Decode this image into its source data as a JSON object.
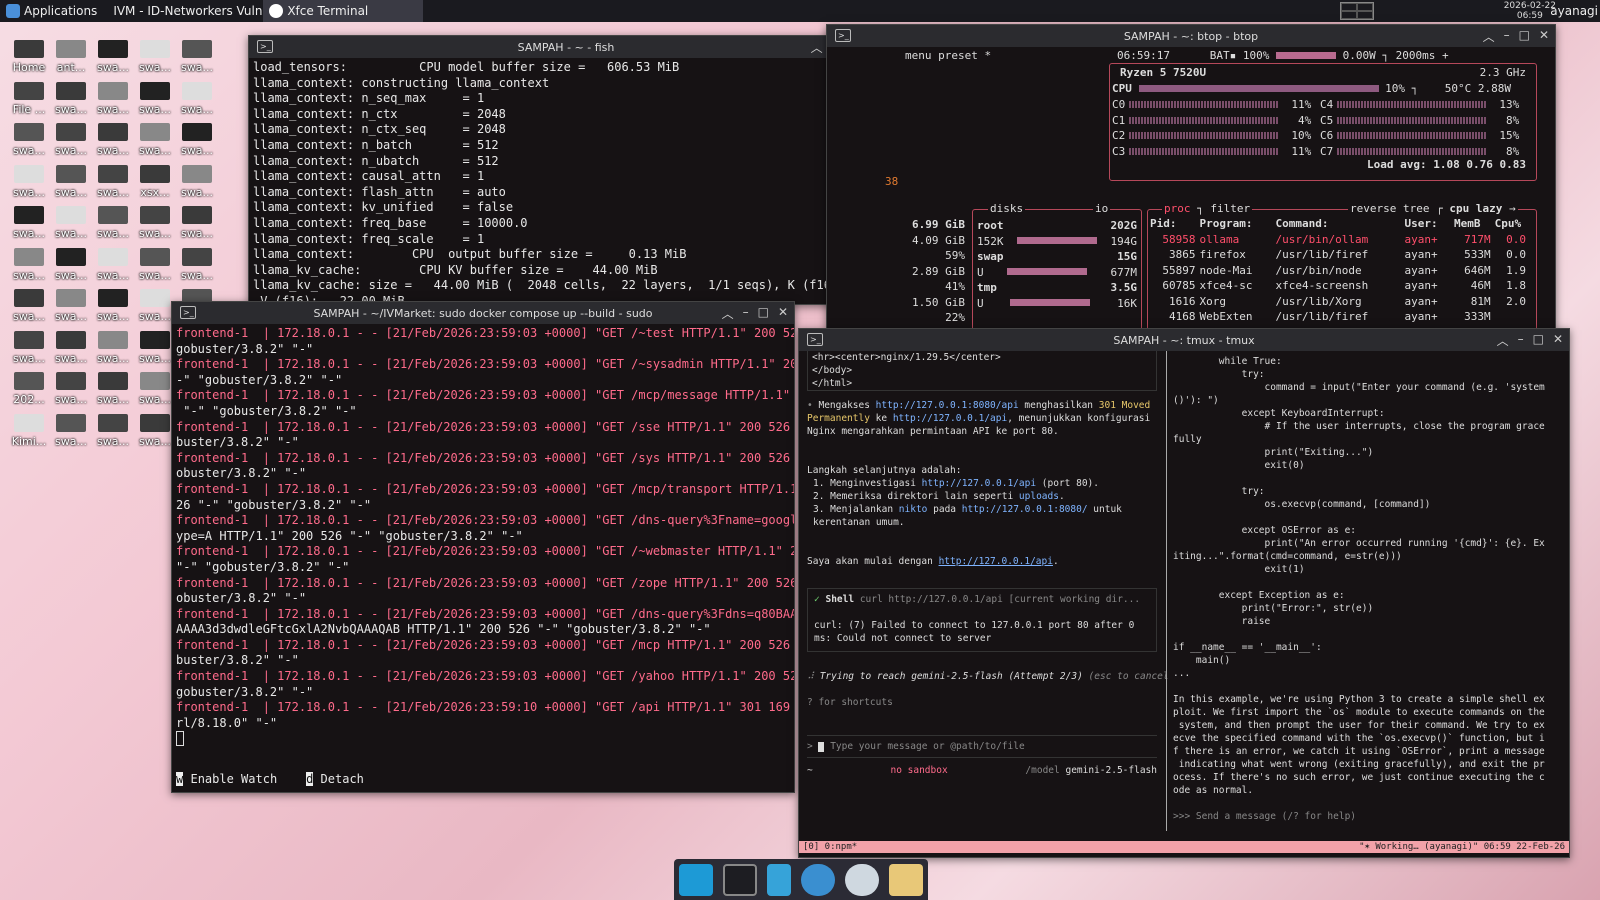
{
  "panel": {
    "applications": "Applications",
    "task1": "IVM - ID-Networkers Vuln...",
    "task2": "Xfce Terminal",
    "date": "2026-02-22",
    "time": "06:59",
    "user": "ayanagi"
  },
  "desktop": {
    "icons": [
      "Home",
      "ant...",
      "swa...",
      "swa...",
      "swa...",
      "File ...",
      "swa...",
      "swa...",
      "swa...",
      "swa...",
      "swa...",
      "swa...",
      "swa...",
      "swa...",
      "swa...",
      "swa...",
      "swa...",
      "swa...",
      "xsx...",
      "swa...",
      "swa...",
      "swa...",
      "swa...",
      "swa...",
      "swa...",
      "swa...",
      "swa...",
      "swa...",
      "swa...",
      "swa...",
      "swa...",
      "swa...",
      "swa...",
      "swa...",
      "swa...",
      "swa...",
      "swa...",
      "swa...",
      "swa...",
      "swa...",
      "202...",
      "swa...",
      "swa...",
      "swa...",
      "swa...",
      "Kimi...",
      "swa...",
      "swa...",
      "swa...",
      "swa..."
    ]
  },
  "fish": {
    "title": "SAMPAH - ~ - fish",
    "lines": [
      "load_tensors:          CPU model buffer size =   606.53 MiB",
      "llama_context: constructing llama_context",
      "llama_context: n_seq_max     = 1",
      "llama_context: n_ctx         = 2048",
      "llama_context: n_ctx_seq     = 2048",
      "llama_context: n_batch       = 512",
      "llama_context: n_ubatch      = 512",
      "llama_context: causal_attn   = 1",
      "llama_context: flash_attn    = auto",
      "llama_context: kv_unified    = false",
      "llama_context: freq_base     = 10000.0",
      "llama_context: freq_scale    = 1",
      "llama_context:        CPU  output buffer size =     0.13 MiB",
      "llama_kv_cache:        CPU KV buffer size =    44.00 MiB",
      "llama_kv_cache: size =   44.00 MiB (  2048 cells,  22 layers,  1/1 seqs), K (f16):   22.00 MiB,",
      " V (f16):   22.00 MiB"
    ]
  },
  "docker": {
    "title": "SAMPAH - ~/IVMarket: sudo docker compose up --build - sudo",
    "lines": [
      "frontend-1  | 172.18.0.1 - - [21/Feb/2026:23:59:03 +0000] \"GET /~test HTTP/1.1\" 200 526 \"-\" \"",
      "gobuster/3.8.2\" \"-\"",
      "frontend-1  | 172.18.0.1 - - [21/Feb/2026:23:59:03 +0000] \"GET /~sysadmin HTTP/1.1\" 200 526",
      "-\" \"gobuster/3.8.2\" \"-\"",
      "frontend-1  | 172.18.0.1 - - [21/Feb/2026:23:59:03 +0000] \"GET /mcp/message HTTP/1.1\" 200 526",
      " \"-\" \"gobuster/3.8.2\" \"-\"",
      "frontend-1  | 172.18.0.1 - - [21/Feb/2026:23:59:03 +0000] \"GET /sse HTTP/1.1\" 200 526 \"-\" \"go",
      "buster/3.8.2\" \"-\"",
      "frontend-1  | 172.18.0.1 - - [21/Feb/2026:23:59:03 +0000] \"GET /sys HTTP/1.1\" 200 526 \"-\" \"g",
      "obuster/3.8.2\" \"-\"",
      "frontend-1  | 172.18.0.1 - - [21/Feb/2026:23:59:03 +0000] \"GET /mcp/transport HTTP/1.1\" 200 5",
      "26 \"-\" \"gobuster/3.8.2\" \"-\"",
      "frontend-1  | 172.18.0.1 - - [21/Feb/2026:23:59:03 +0000] \"GET /dns-query%3Fname=google.com&t",
      "ype=A HTTP/1.1\" 200 526 \"-\" \"gobuster/3.8.2\" \"-\"",
      "frontend-1  | 172.18.0.1 - - [21/Feb/2026:23:59:03 +0000] \"GET /~webmaster HTTP/1.1\" 200 526",
      "\"-\" \"gobuster/3.8.2\" \"-\"",
      "frontend-1  | 172.18.0.1 - - [21/Feb/2026:23:59:03 +0000] \"GET /zope HTTP/1.1\" 200 526 \"-\" \"g",
      "obuster/3.8.2\" \"-\"",
      "frontend-1  | 172.18.0.1 - - [21/Feb/2026:23:59:03 +0000] \"GET /dns-query%3Fdns=q80BAAABAAAAA",
      "AAAA3d3dwdleGFtcGxlA2NvbQAAAQAB HTTP/1.1\" 200 526 \"-\" \"gobuster/3.8.2\" \"-\"",
      "frontend-1  | 172.18.0.1 - - [21/Feb/2026:23:59:03 +0000] \"GET /mcp HTTP/1.1\" 200 526 \"-\" \"go",
      "buster/3.8.2\" \"-\"",
      "frontend-1  | 172.18.0.1 - - [21/Feb/2026:23:59:03 +0000] \"GET /yahoo HTTP/1.1\" 200 526 \"-\" \"",
      "gobuster/3.8.2\" \"-\"",
      "frontend-1  | 172.18.0.1 - - [21/Feb/2026:23:59:10 +0000] \"GET /api HTTP/1.1\" 301 169 \"-\" \"cu",
      "rl/8.18.0\" \"-\""
    ],
    "watch": "Enable Watch",
    "detach": "Detach",
    "watch_key": "w",
    "detach_key": "d"
  },
  "btop": {
    "title": "SAMPAH - ~: btop - btop",
    "menu": "menu",
    "preset": "preset *",
    "clock": "06:59:17",
    "bat": "BAT▪ 100%",
    "power": "0.00W",
    "interval": "2000ms",
    "cpu_name": "Ryzen 5 7520U",
    "freq": "2.3 GHz",
    "cpu_label": "CPU",
    "cpu_pct": "10%",
    "temp": "50°C",
    "watts": "2.88W",
    "cores": [
      {
        "n": "C0",
        "v": "11%"
      },
      {
        "n": "C1",
        "v": "4%"
      },
      {
        "n": "C2",
        "v": "10%"
      },
      {
        "n": "C3",
        "v": "11%"
      },
      {
        "n": "C4",
        "v": "13%"
      },
      {
        "n": "C5",
        "v": "8%"
      },
      {
        "n": "C6",
        "v": "15%"
      },
      {
        "n": "C7",
        "v": "8%"
      }
    ],
    "load": "Load avg: 1.08 0.76 0.83",
    "left_num": "38",
    "mem_total": "6.99 GiB",
    "mem_vals": [
      "4.09 GiB",
      "59%",
      "2.89 GiB",
      "41%",
      "1.50 GiB",
      "22%"
    ],
    "disks_label": "disks",
    "io_label": "io",
    "disks": [
      {
        "name": "root",
        "size": "202G",
        "used": "152K",
        "free": "194G"
      },
      {
        "name": "swap",
        "size": "15G",
        "free": "677M"
      },
      {
        "name": "tmp",
        "size": "3.5G",
        "free": "16K"
      }
    ],
    "proc_label": "proc",
    "filter": "filter",
    "reverse": "reverse",
    "tree": "tree",
    "sort": "cpu lazy",
    "proc_header": [
      "Pid:",
      "Program:",
      "Command:",
      "User:",
      "MemB",
      "Cpu%"
    ],
    "procs": [
      {
        "pid": "58958",
        "prog": "ollama",
        "cmd": "/usr/bin/ollam",
        "user": "ayan+",
        "mem": "717M",
        "cpu": "0.0"
      },
      {
        "pid": "3865",
        "prog": "firefox",
        "cmd": "/usr/lib/firef",
        "user": "ayan+",
        "mem": "533M",
        "cpu": "0.0"
      },
      {
        "pid": "55897",
        "prog": "node-Mai",
        "cmd": "/usr/bin/node",
        "user": "ayan+",
        "mem": "646M",
        "cpu": "1.9"
      },
      {
        "pid": "60785",
        "prog": "xfce4-sc",
        "cmd": "xfce4-screensh",
        "user": "ayan+",
        "mem": "46M",
        "cpu": "1.8"
      },
      {
        "pid": "1616",
        "prog": "Xorg",
        "cmd": "/usr/lib/Xorg",
        "user": "ayan+",
        "mem": "81M",
        "cpu": "2.0"
      },
      {
        "pid": "4168",
        "prog": "WebExten",
        "cmd": "/usr/lib/firef",
        "user": "ayan+",
        "mem": "333M",
        "cpu": ""
      }
    ]
  },
  "tmux": {
    "title": "SAMPAH - ~: tmux - tmux",
    "html_lines": [
      "<hr><center>nginx/1.29.5</center>",
      "</body>",
      "</html>"
    ],
    "para1_a": "Mengakses ",
    "para1_link1": "http://127.0.0.1:8080/api",
    "para1_b": " menghasilkan ",
    "para1_moved": "301 Moved Permanently",
    "para1_c": " ke ",
    "para1_link2": "http://127.0.0.1/api",
    "para1_d": ", menunjukkan konfigurasi Nginx mengarahkan permintaan API ke port 80.",
    "steps_title": "Langkah selanjutnya adalah:",
    "step1_a": "1. Menginvestigasi ",
    "step1_link": "http://127.0.0.1/api",
    "step1_b": " (port 80).",
    "step2_a": "2. Memeriksa direktori lain seperti ",
    "step2_link": "uploads",
    "step3_a": "3. Menjalankan ",
    "step3_tool": "nikto",
    "step3_b": " pada ",
    "step3_link": "http://127.0.0.1:8080/",
    "step3_c": " untuk kerentanan umum.",
    "start_a": "Saya akan mulai dengan ",
    "start_link": "http://127.0.0.1/api",
    "shell_label": "Shell",
    "shell_cmd": "curl http://127.0.0.1/api [current working dir...",
    "curl_err": "curl: (7) Failed to connect to 127.0.0.1 port 80 after 0 ms: Could not connect to server",
    "trying": "Trying to reach gemini-2.5-flash (Attempt 2/3)",
    "esc": "(esc to cancel",
    "shortcuts": "? for shortcuts",
    "input_placeholder": "Type your message or @path/to/file",
    "tilde": "~",
    "sandbox": "no sandbox",
    "model_label": "/model",
    "model": "gemini-2.5-flash",
    "code": [
      "        while True:",
      "            try:",
      "                command = input(\"Enter your command (e.g. 'system",
      "()'): \")",
      "            except KeyboardInterrupt:",
      "                # If the user interrupts, close the program grace",
      "fully",
      "                print(\"Exiting...\")",
      "                exit(0)",
      "",
      "            try:",
      "                os.execvp(command, [command])",
      "",
      "            except OSError as e:",
      "                print(\"An error occurred running '{cmd}': {e}. Ex",
      "iting...\".format(cmd=command, e=str(e)))",
      "                exit(1)",
      "",
      "        except Exception as e:",
      "            print(\"Error:\", str(e))",
      "            raise",
      "",
      "if __name__ == '__main__':",
      "    main()",
      "..."
    ],
    "explain": [
      "In this example, we're using Python 3 to create a simple shell ex",
      "ploit. We first import the `os` module to execute commands on the",
      " system, and then prompt the user for their command. We try to ex",
      "ecve the specified command with the `os.execvp()` function, but i",
      "f there is an error, we catch it using `OSError`, print a message",
      " indicating what went wrong (exiting gracefully), and exit the pr",
      "ocess. If there's no such error, we just continue executing the c",
      "ode as normal."
    ],
    "prompt": ">>> Send a message (/? for help)",
    "status_left": "[0] 0:npm*",
    "status_right": "\"✶ Working… (ayanagi)\" 06:59 22-Feb-26"
  }
}
